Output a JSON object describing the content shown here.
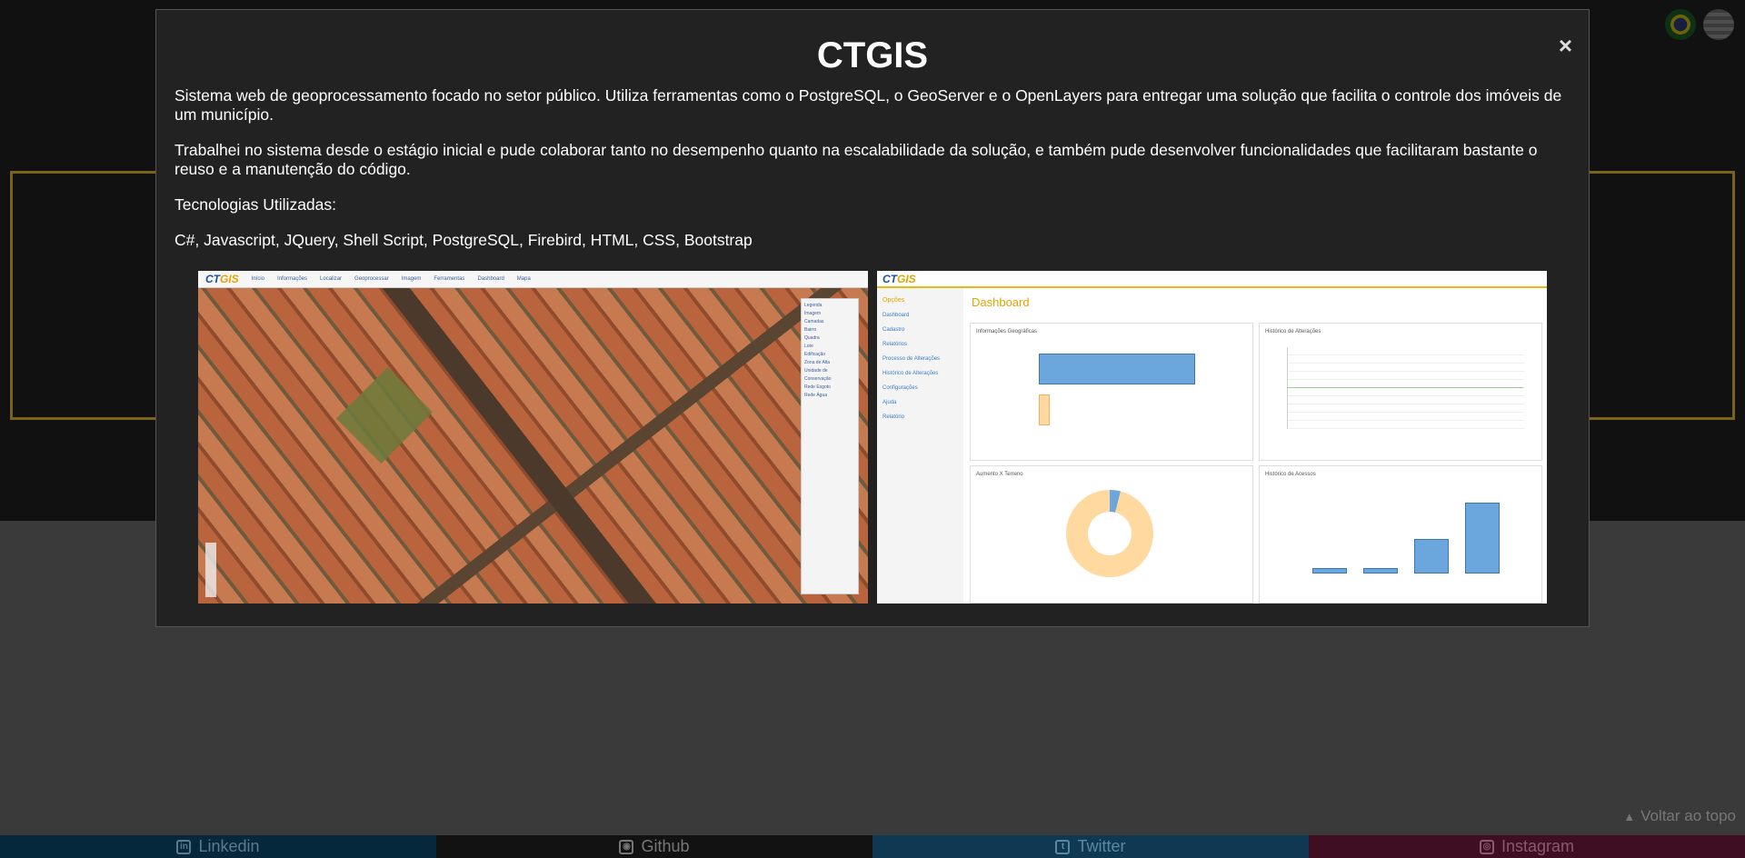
{
  "modal": {
    "title": "CTGIS",
    "close_symbol": "×",
    "paragraphs": [
      "Sistema web de geoprocessamento focado no setor público. Utiliza ferramentas como o PostgreSQL, o GeoServer e o OpenLayers para entregar uma solução que facilita o controle dos imóveis de um município.",
      "Trabalhei no sistema desde o estágio inicial e pude colaborar tanto no desempenho quanto na escalabilidade da solução, e também pude desenvolver funcionalidades que facilitaram bastante o reuso e a manutenção do código.",
      "Tecnologias Utilizadas:",
      "C#, Javascript, JQuery, Shell Script, PostgreSQL, Firebird, HTML, CSS, Bootstrap"
    ]
  },
  "screenshot_map": {
    "logo_main": "CT",
    "logo_accent": "GIS",
    "nav": [
      "Início",
      "Informações",
      "Localizar",
      "Geoprocessar",
      "Imagem",
      "Ferramentas",
      "Dashboard",
      "Mapa"
    ],
    "side_title": "Legenda",
    "side_items": [
      "Imagem",
      "Camadas",
      "Bairro",
      "Quadra",
      "Lote",
      "Edificação",
      "Zona de Alta",
      "Unidade de Conservação",
      "Rede Esgoto",
      "Rede Água"
    ]
  },
  "screenshot_dashboard": {
    "logo_main": "CT",
    "logo_accent": "GIS",
    "side_header": "Opções",
    "side_items": [
      "Dashboard",
      "Cadastro",
      "Relatórios",
      "Processo de Alterações",
      "Histórico de Alterações",
      "Configurações",
      "Ajuda",
      "Relatório"
    ],
    "title": "Dashboard",
    "panels": [
      "Informações Geográficas",
      "Histórico de Alterações",
      "Aumento X Terreno",
      "Histórico de Acessos"
    ]
  },
  "footer": {
    "back_to_top": "Voltar ao topo",
    "links": [
      {
        "label": "Linkedin",
        "icon": "linkedin-icon"
      },
      {
        "label": "Github",
        "icon": "github-icon"
      },
      {
        "label": "Twitter",
        "icon": "twitter-icon"
      },
      {
        "label": "Instagram",
        "icon": "instagram-icon"
      }
    ]
  },
  "colors": {
    "accent_gold": "#e2a400",
    "linkedin": "#06283d",
    "github": "#121212",
    "twitter": "#0f3952",
    "instagram": "#3f0e22"
  }
}
